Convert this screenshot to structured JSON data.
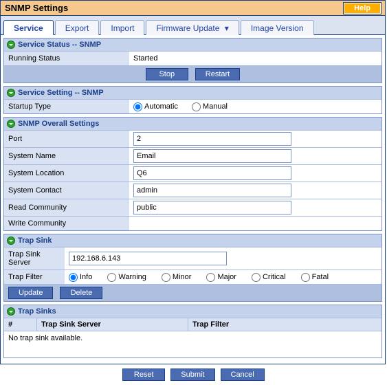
{
  "title": "SNMP Settings",
  "help_label": "Help",
  "tabs": {
    "service": "Service",
    "export": "Export",
    "import": "Import",
    "firmware": "Firmware Update",
    "image_ver": "Image Version"
  },
  "service_status": {
    "header": "Service Status -- SNMP",
    "running_status_label": "Running Status",
    "running_status_value": "Started",
    "stop_label": "Stop",
    "restart_label": "Restart"
  },
  "service_setting": {
    "header": "Service Setting -- SNMP",
    "startup_type_label": "Startup Type",
    "automatic_label": "Automatic",
    "manual_label": "Manual"
  },
  "overall": {
    "header": "SNMP Overall Settings",
    "port_label": "Port",
    "port_value": "2",
    "system_name_label": "System Name",
    "system_name_value": "Email",
    "system_location_label": "System Location",
    "system_location_value": "Q6",
    "system_contact_label": "System Contact",
    "system_contact_value": "admin",
    "read_community_label": "Read Community",
    "read_community_value": "public",
    "write_community_label": "Write Community",
    "write_community_value": ""
  },
  "trap_sink": {
    "header": "Trap Sink",
    "server_label": "Trap Sink Server",
    "server_value": "192.168.6.143",
    "filter_label": "Trap Filter",
    "filters": {
      "info": "Info",
      "warning": "Warning",
      "minor": "Minor",
      "major": "Major",
      "critical": "Critical",
      "fatal": "Fatal"
    },
    "update_label": "Update",
    "delete_label": "Delete"
  },
  "trap_sinks_table": {
    "header": "Trap Sinks",
    "col_num": "#",
    "col_server": "Trap Sink Server",
    "col_filter": "Trap Filter",
    "empty": "No trap sink available."
  },
  "footer": {
    "reset": "Reset",
    "submit": "Submit",
    "cancel": "Cancel"
  }
}
